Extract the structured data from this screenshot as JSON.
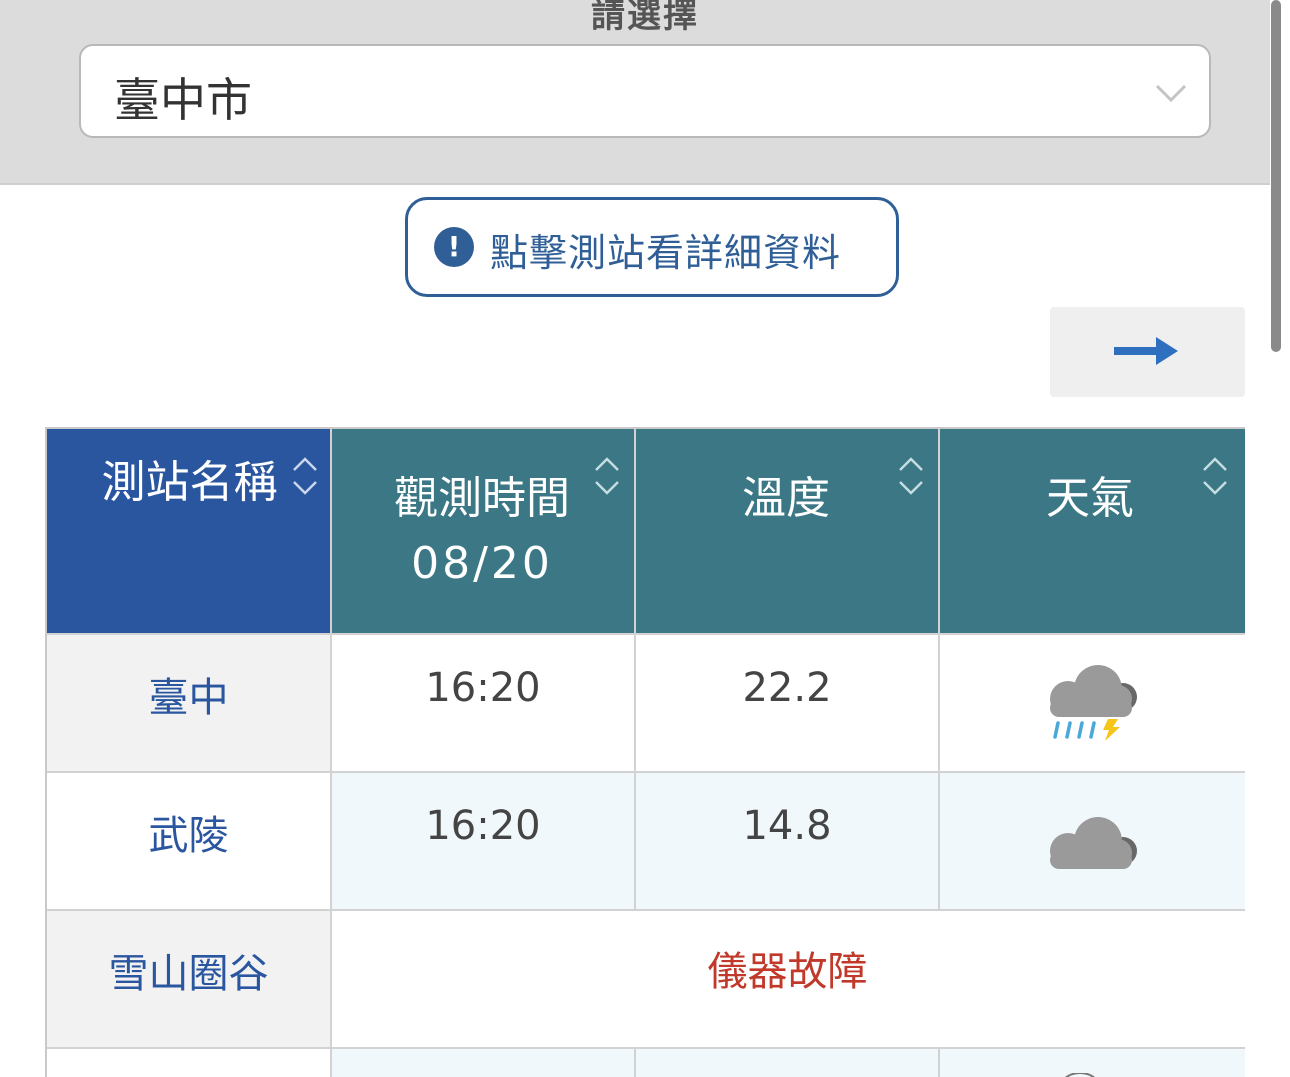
{
  "region_selector": {
    "label": "請選擇",
    "value": "臺中市"
  },
  "hint": {
    "icon": "!",
    "text": "點擊測站看詳細資料"
  },
  "scroll_button": {
    "icon": "arrow-right-icon",
    "color": "#2f6fc0"
  },
  "table": {
    "headers": {
      "station": "測站名稱",
      "time": "觀測時間",
      "date": "08/20",
      "temp": "溫度",
      "weather": "天氣"
    },
    "rows": [
      {
        "station": "臺中",
        "time": "16:20",
        "temp": "22.2",
        "weather_icon": "thunderstorm-icon"
      },
      {
        "station": "武陵",
        "time": "16:20",
        "temp": "14.8",
        "weather_icon": "cloud-icon"
      },
      {
        "station": "雪山圈谷",
        "status": "儀器故障"
      }
    ]
  },
  "colors": {
    "station_header": "#2a56a0",
    "column_header": "#3b7785",
    "link_text": "#2a56a0",
    "error_text": "#c0392b"
  }
}
